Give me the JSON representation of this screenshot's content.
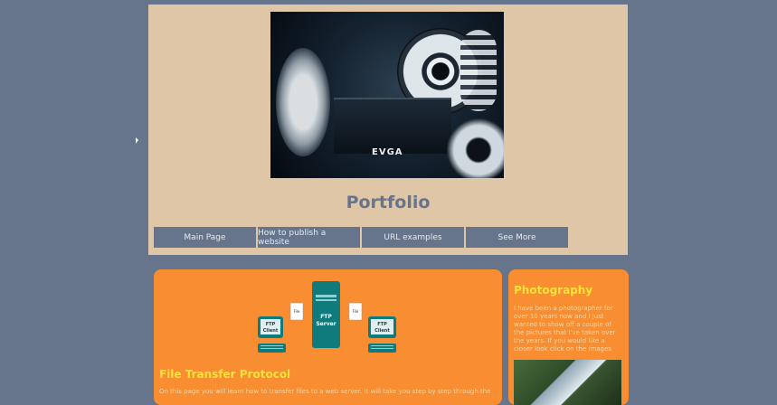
{
  "header": {
    "title": "Portfolio",
    "hero_image": {
      "icon": "pc-hardware-photo",
      "brand_text": "EVGA"
    }
  },
  "nav": {
    "items": [
      {
        "label": "Main Page"
      },
      {
        "label": "How to publish a website"
      },
      {
        "label": "URL examples"
      },
      {
        "label": "See More"
      }
    ]
  },
  "main_card": {
    "diagram": {
      "server_label_1": "FTP",
      "server_label_2": "Server",
      "client_left_1": "FTP",
      "client_left_2": "Client",
      "client_right_1": "FTP",
      "client_right_2": "Client",
      "file_left": "File",
      "file_right": "File"
    },
    "title": "File Transfer Protocol",
    "text": "On this page you will learn how to transfer files to a web server. It will take you step by step through the"
  },
  "side_card": {
    "title": "Photography",
    "text": "I have been a photographer for over 10 years now and I just wanted to show off a couple of the pictures that I've taken over the years. If you would like a closer look click on the images",
    "photo_icon": "photograph"
  },
  "colors": {
    "background": "#66748c",
    "header_bg": "#dec6a6",
    "card_bg": "#f88d31",
    "card_title": "#ffe33b",
    "teal": "#0f7b7d"
  }
}
